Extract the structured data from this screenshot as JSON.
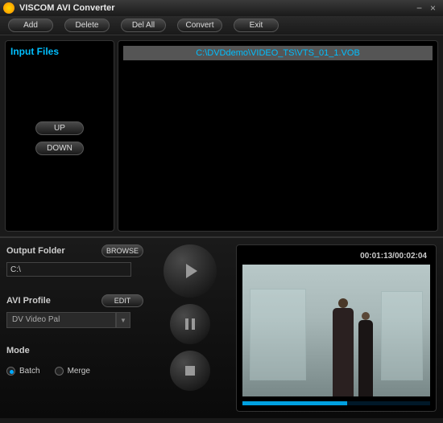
{
  "title": "VISCOM AVI Converter",
  "toolbar": {
    "add": "Add",
    "delete": "Delete",
    "delall": "Del All",
    "convert": "Convert",
    "exit": "Exit"
  },
  "left": {
    "title": "Input Files",
    "up": "UP",
    "down": "DOWN"
  },
  "files": {
    "item0": "C:\\DVDdemo\\VIDEO_TS\\VTS_01_1.VOB"
  },
  "settings": {
    "outlabel": "Output Folder",
    "browse": "BROWSE",
    "outpath": "C:\\",
    "profilelabel": "AVI Profile",
    "edit": "EDIT",
    "profile": "DV Video Pal",
    "modelabel": "Mode",
    "batch": "Batch",
    "merge": "Merge"
  },
  "preview": {
    "time": "00:01:13/00:02:04"
  }
}
